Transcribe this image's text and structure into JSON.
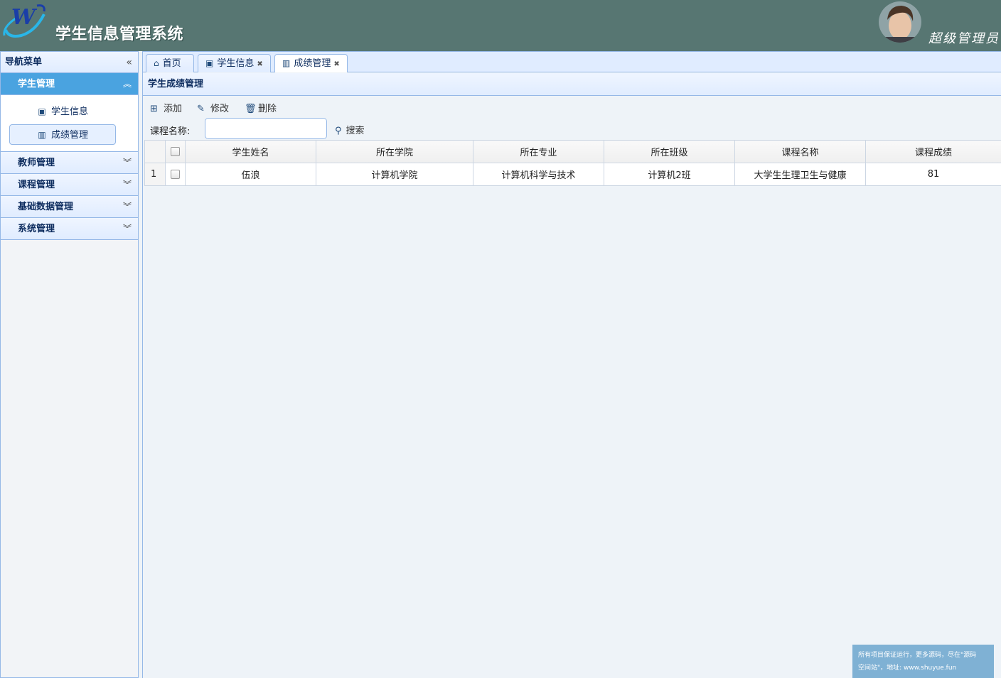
{
  "header": {
    "app_title": "学生信息管理系统",
    "user_role": "超级管理员",
    "logo_icon": "w-logo-icon",
    "header_color": "#577672"
  },
  "sidebar": {
    "title": "导航菜单",
    "collapse_icon": "double-chevron-left-icon",
    "groups": [
      {
        "label": "学生管理",
        "expanded": true,
        "items": [
          {
            "label": "学生信息",
            "icon": "user-card-icon"
          },
          {
            "label": "成绩管理",
            "icon": "bar-chart-icon",
            "selected": true
          }
        ]
      },
      {
        "label": "教师管理",
        "expanded": false
      },
      {
        "label": "课程管理",
        "expanded": false
      },
      {
        "label": "基础数据管理",
        "expanded": false
      },
      {
        "label": "系统管理",
        "expanded": false
      }
    ]
  },
  "tabs": [
    {
      "label": "首页",
      "icon": "home-icon",
      "closable": false
    },
    {
      "label": "学生信息",
      "icon": "user-card-icon",
      "closable": true
    },
    {
      "label": "成绩管理",
      "icon": "bar-chart-icon",
      "closable": true,
      "active": true
    }
  ],
  "panel": {
    "title": "学生成绩管理",
    "toolbar": {
      "add_label": "添加",
      "edit_label": "修改",
      "delete_label": "删除"
    },
    "search": {
      "label": "课程名称:",
      "value": "",
      "button_label": "搜索"
    },
    "grid": {
      "columns": [
        "学生姓名",
        "所在学院",
        "所在专业",
        "所在班级",
        "课程名称",
        "课程成绩"
      ],
      "rows": [
        {
          "num": "1",
          "cells": [
            "伍浪",
            "计算机学院",
            "计算机科学与技术",
            "计算机2班",
            "大学生生理卫生与健康",
            "81"
          ]
        }
      ]
    }
  },
  "footer_note": {
    "line1": "所有项目保证运行，更多源码，尽在\"源码",
    "line2": "空间站\"，地址: www.shuyue.fun"
  }
}
